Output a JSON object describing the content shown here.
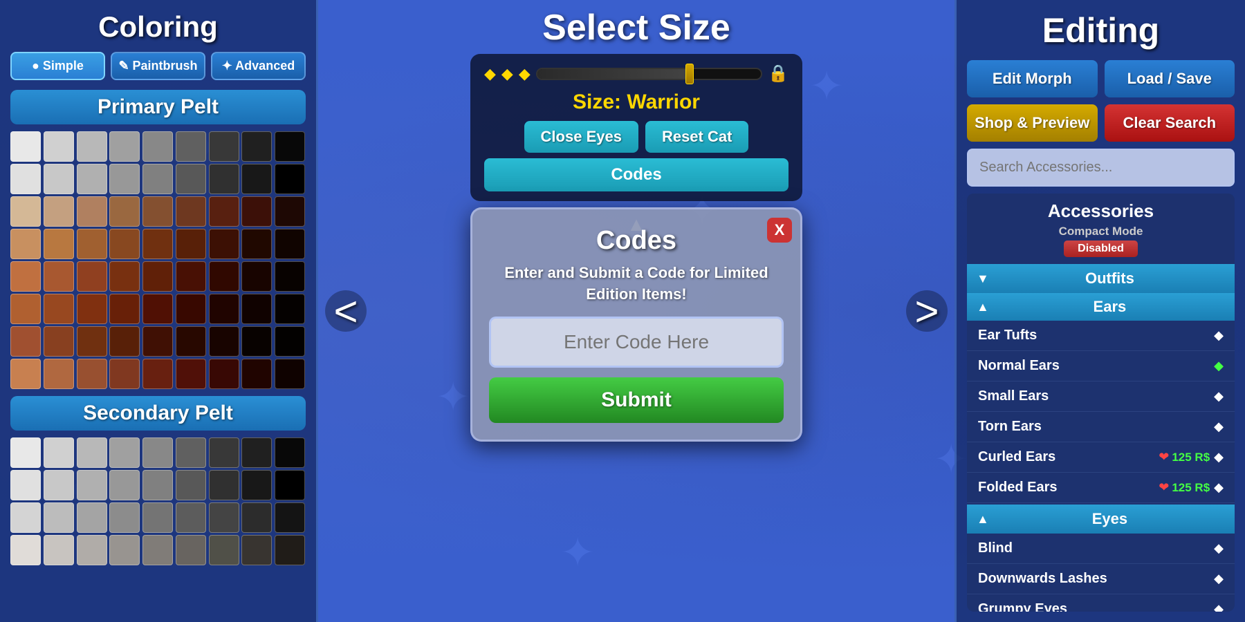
{
  "left": {
    "title": "Coloring",
    "buttons": [
      {
        "label": "● Simple",
        "active": true
      },
      {
        "label": "✎ Paintbrush",
        "active": false
      },
      {
        "label": "✦ Advanced",
        "active": false
      }
    ],
    "primary_pelt_label": "Primary Pelt",
    "secondary_pelt_label": "Secondary Pelt",
    "primary_colors": [
      "#e8e8e8",
      "#d0d0d0",
      "#b8b8b8",
      "#a0a0a0",
      "#888888",
      "#606060",
      "#383838",
      "#202020",
      "#080808",
      "#e0e0e0",
      "#c8c8c8",
      "#b0b0b0",
      "#989898",
      "#808080",
      "#585858",
      "#303030",
      "#181818",
      "#000000",
      "#d4b896",
      "#c4a080",
      "#b08060",
      "#9a6840",
      "#845030",
      "#6e3820",
      "#582010",
      "#3c1008",
      "#1e0804",
      "#c89060",
      "#b87840",
      "#a06030",
      "#884820",
      "#703010",
      "#582008",
      "#3c1004",
      "#200800",
      "#100400",
      "#c07040",
      "#a85830",
      "#904020",
      "#783010",
      "#602008",
      "#481004",
      "#300800",
      "#180400",
      "#080200",
      "#b06030",
      "#984820",
      "#803010",
      "#682008",
      "#501004",
      "#380800",
      "#200400",
      "#100200",
      "#050100",
      "#a05030",
      "#884020",
      "#703010",
      "#582008",
      "#401004",
      "#280800",
      "#180400",
      "#080200",
      "#030100",
      "#c88050",
      "#b06840",
      "#985030",
      "#803820",
      "#682010",
      "#501008",
      "#380804",
      "#200400",
      "#0f0200"
    ],
    "secondary_colors": [
      "#e8e8e8",
      "#d0d0d0",
      "#b8b8b8",
      "#a0a0a0",
      "#888888",
      "#606060",
      "#383838",
      "#202020",
      "#080808",
      "#e0e0e0",
      "#c8c8c8",
      "#b0b0b0",
      "#989898",
      "#808080",
      "#585858",
      "#303030",
      "#181818",
      "#000000",
      "#d4d4d4",
      "#bcbcbc",
      "#a4a4a4",
      "#8c8c8c",
      "#747474",
      "#5c5c5c",
      "#444444",
      "#2c2c2c",
      "#141414",
      "#e0dcd8",
      "#c8c4c0",
      "#b0aca8",
      "#989490",
      "#807c78",
      "#686460",
      "#505048",
      "#383430",
      "#201c18"
    ]
  },
  "center": {
    "select_size_title": "Select Size",
    "size_label": "Size: Warrior",
    "close_eyes_btn": "Close Eyes",
    "reset_cat_btn": "Reset Cat",
    "codes_btn": "Codes",
    "chevron_up": "^",
    "nav_left": "<",
    "nav_right": ">"
  },
  "codes_modal": {
    "title": "Codes",
    "description": "Enter and Submit a Code for Limited Edition Items!",
    "input_placeholder": "Enter Code Here",
    "submit_label": "Submit",
    "close_label": "X"
  },
  "right": {
    "title": "Editing",
    "edit_morph_label": "Edit Morph",
    "load_save_label": "Load / Save",
    "shop_preview_label": "Shop & Preview",
    "clear_search_label": "Clear Search",
    "search_placeholder": "Search Accessories...",
    "accessories_title": "Accessories",
    "compact_mode_label": "Compact Mode",
    "compact_mode_status": "Disabled",
    "categories": [
      {
        "name": "Outfits",
        "expanded": true,
        "sub_categories": [
          {
            "name": "Ears",
            "expanded": true,
            "items": [
              {
                "name": "Ear Tufts",
                "diamond": "white",
                "price": null
              },
              {
                "name": "Normal Ears",
                "diamond": "green",
                "price": null
              },
              {
                "name": "Small Ears",
                "diamond": "white",
                "price": null
              },
              {
                "name": "Torn Ears",
                "diamond": "white",
                "price": null
              },
              {
                "name": "Curled Ears",
                "diamond": "white",
                "price": "125 R$",
                "locked": true
              },
              {
                "name": "Folded Ears",
                "diamond": "white",
                "price": "125 R$",
                "locked": true
              }
            ]
          }
        ]
      },
      {
        "name": "Eyes",
        "expanded": true,
        "items": [
          {
            "name": "Blind",
            "diamond": "white",
            "price": null
          },
          {
            "name": "Downwards Lashes",
            "diamond": "white",
            "price": null
          },
          {
            "name": "Grumpy Eyes",
            "diamond": "white",
            "price": null
          }
        ]
      }
    ]
  }
}
